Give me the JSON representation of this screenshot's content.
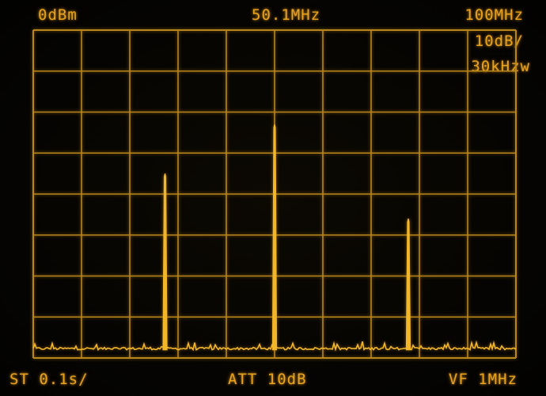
{
  "display": {
    "ref_level": "0dBm",
    "center_freq": "50.1MHz",
    "span": "100MHz",
    "scale": "10dB/",
    "rbw": "30kHzw",
    "sweep_time": "ST 0.1s/",
    "attenuation": "ATT 10dB",
    "video_filter": "VF 1MHz"
  },
  "colors": {
    "trace": "#f2b62a",
    "graticule": "#b8861a",
    "text": "#e8a21e",
    "background": "#050402"
  },
  "chart_data": {
    "type": "line",
    "xlabel": "",
    "ylabel": "",
    "xlim": [
      0.1,
      100.1
    ],
    "ylim": [
      -80,
      0
    ],
    "grid": true,
    "x_unit": "MHz",
    "y_unit": "dBm",
    "noise_floor_dbm": -78,
    "peaks": [
      {
        "freq_mhz": 27.4,
        "level_dbm": -35
      },
      {
        "freq_mhz": 50.1,
        "level_dbm": -23
      },
      {
        "freq_mhz": 77.8,
        "level_dbm": -46
      }
    ]
  }
}
